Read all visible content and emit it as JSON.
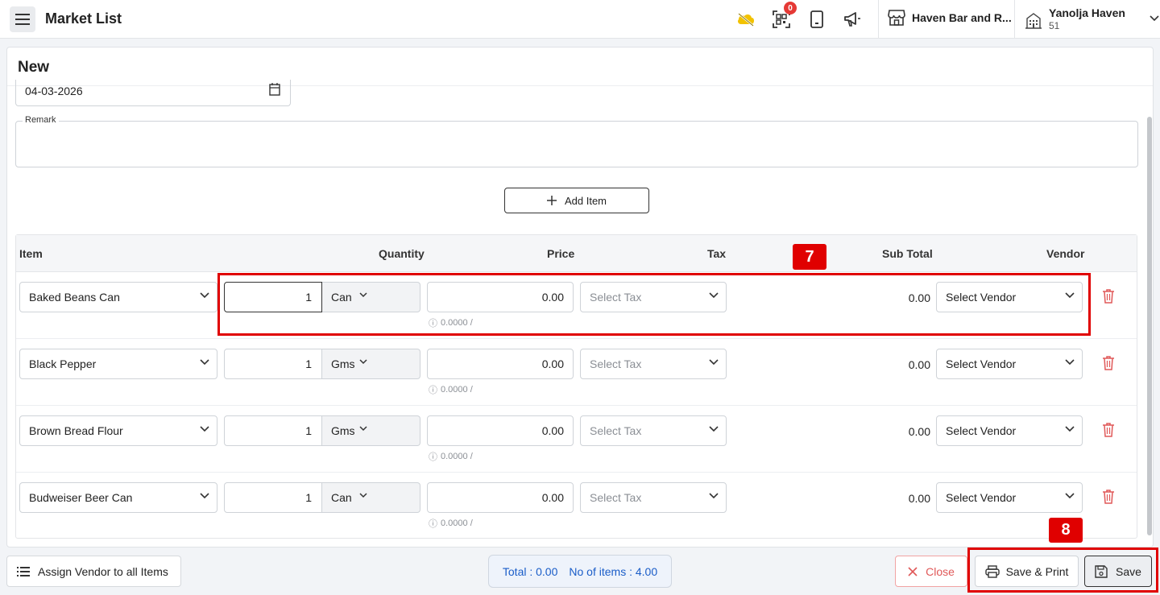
{
  "header": {
    "title": "Market List",
    "notification_count": "0",
    "outlet_name": "Haven Bar and R...",
    "user_name": "Yanolja Haven",
    "user_sub": "51",
    "icons": [
      "menu-icon",
      "cloud-off-icon",
      "qr-scanner-icon",
      "tablet-icon",
      "megaphone-icon",
      "store-icon",
      "building-icon",
      "chevron-down-icon"
    ]
  },
  "form": {
    "title": "New",
    "date_value": "04-03-2026",
    "remark_label": "Remark",
    "add_item_label": "Add Item"
  },
  "table": {
    "columns": {
      "item": "Item",
      "quantity": "Quantity",
      "price": "Price",
      "tax": "Tax",
      "subtotal": "Sub Total",
      "vendor": "Vendor"
    },
    "tax_placeholder": "Select Tax",
    "vendor_placeholder": "Select Vendor",
    "rows": [
      {
        "item": "Baked Beans Can",
        "qty": "1",
        "unit": "Can",
        "price": "0.00",
        "hint": "0.0000 /",
        "subtotal": "0.00"
      },
      {
        "item": "Black Pepper",
        "qty": "1",
        "unit": "Gms",
        "price": "0.00",
        "hint": "0.0000 /",
        "subtotal": "0.00"
      },
      {
        "item": "Brown Bread Flour",
        "qty": "1",
        "unit": "Gms",
        "price": "0.00",
        "hint": "0.0000 /",
        "subtotal": "0.00"
      },
      {
        "item": "Budweiser Beer Can",
        "qty": "1",
        "unit": "Can",
        "price": "0.00",
        "hint": "0.0000 /",
        "subtotal": "0.00"
      }
    ]
  },
  "footer": {
    "assign_vendor_label": "Assign Vendor to all Items",
    "total_label": "Total : 0.00",
    "items_label": "No of items : 4.00",
    "close_label": "Close",
    "save_print_label": "Save & Print",
    "save_label": "Save"
  },
  "annotations": {
    "tag_7": "7",
    "tag_8": "8",
    "color": "#e00000"
  },
  "colors": {
    "accent_blue": "#1a5dc8",
    "danger": "#e05858",
    "notification_badge": "#e53935"
  }
}
